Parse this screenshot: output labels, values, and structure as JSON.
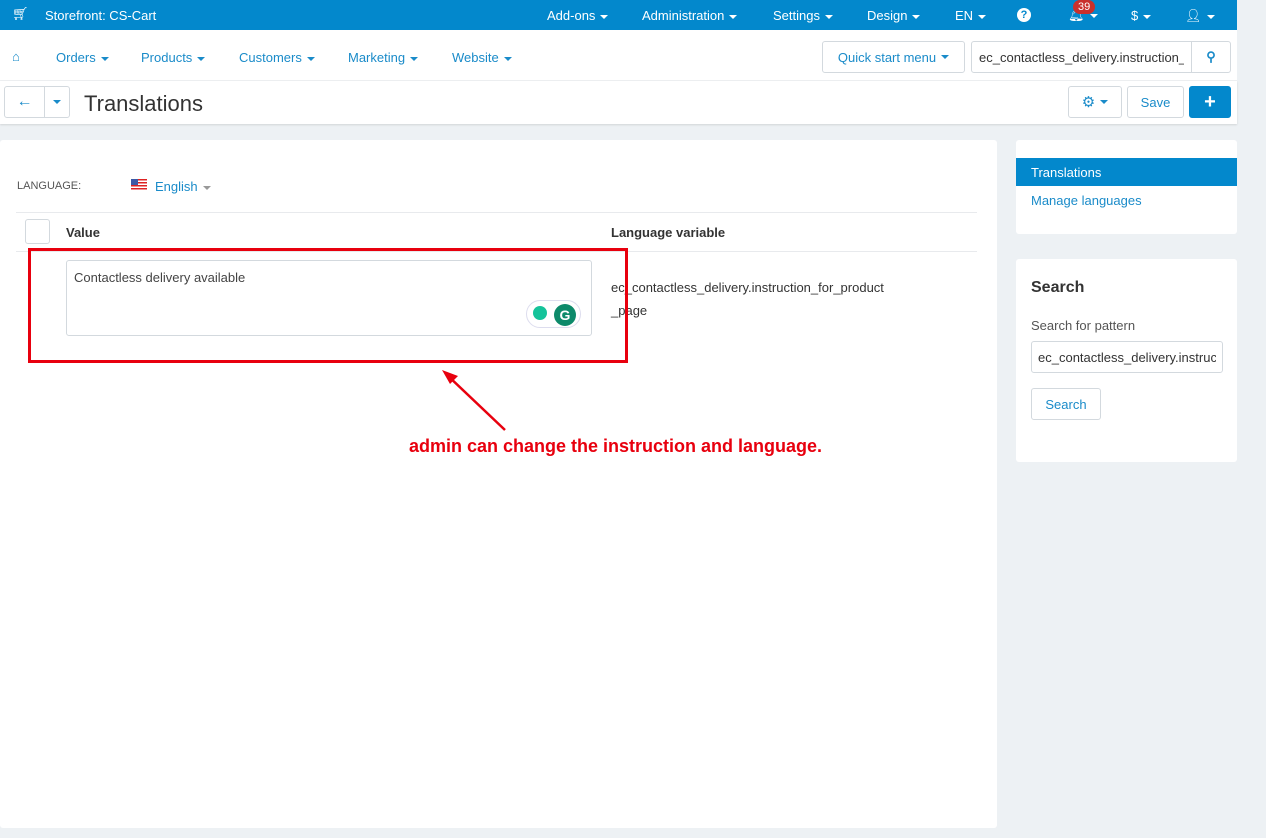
{
  "topbar": {
    "storefront": "Storefront: CS-Cart",
    "menus": [
      "Add-ons",
      "Administration",
      "Settings",
      "Design",
      "EN"
    ],
    "notifications": "39",
    "currency": "$",
    "icons": [
      "cart-icon",
      "help-icon",
      "bell-icon",
      "user-icon"
    ]
  },
  "nav": {
    "items": [
      "Orders",
      "Products",
      "Customers",
      "Marketing",
      "Website"
    ],
    "quick_start": "Quick start menu",
    "search_value": "ec_contactless_delivery.instruction_for_product_page"
  },
  "toolbar": {
    "title": "Translations",
    "save": "Save"
  },
  "main": {
    "language_label": "LANGUAGE:",
    "language": "English",
    "columns": {
      "value": "Value",
      "variable": "Language variable"
    },
    "rows": [
      {
        "value": "Contactless delivery available",
        "variable": "ec_contactless_delivery.instruction_for_product",
        "variable_cont": "_page"
      }
    ]
  },
  "sidebar": {
    "items": [
      {
        "label": "Translations",
        "active": true
      },
      {
        "label": "Manage languages"
      }
    ],
    "search_title": "Search",
    "search_label": "Search for pattern",
    "search_value": "ec_contactless_delivery.instruction_for_product_page",
    "search_button": "Search"
  },
  "annotation": {
    "text": "admin can change the instruction and language.",
    "color": "#e8000e"
  },
  "colors": {
    "brand": "#0388cc",
    "link": "#1a8bc9"
  }
}
